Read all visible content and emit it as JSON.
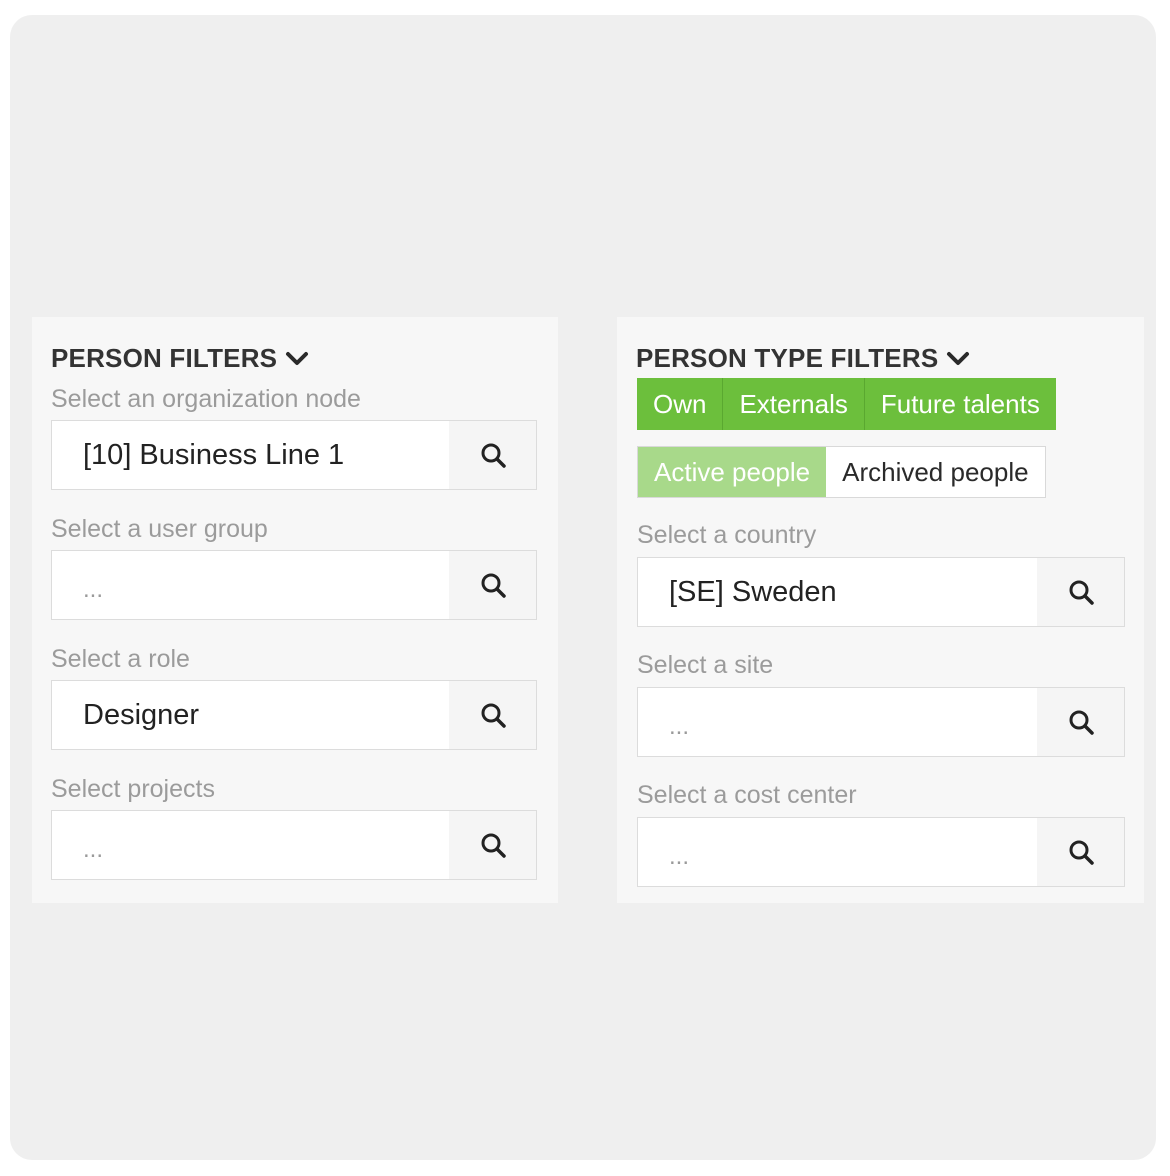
{
  "person_filters": {
    "title": "PERSON FILTERS",
    "fields": [
      {
        "label": "Select an organization node",
        "value": "[10] Business Line 1"
      },
      {
        "label": "Select a user group",
        "placeholder": "..."
      },
      {
        "label": "Select a role",
        "value": "Designer"
      },
      {
        "label": "Select projects",
        "placeholder": "..."
      }
    ]
  },
  "person_type_filters": {
    "title": "PERSON TYPE FILTERS",
    "type_buttons": [
      "Own",
      "Externals",
      "Future talents"
    ],
    "status_buttons": {
      "active": "Active people",
      "archived": "Archived people"
    },
    "fields": [
      {
        "label": "Select a country",
        "value": "[SE] Sweden"
      },
      {
        "label": "Select a site",
        "placeholder": "..."
      },
      {
        "label": "Select a cost center",
        "placeholder": "..."
      }
    ]
  },
  "icons": {
    "search": "search-icon",
    "chevron": "chevron-down-icon"
  },
  "colors": {
    "accent": "#6cbf3c",
    "accent_light": "#a8d98a",
    "label": "#9b9b9b"
  }
}
